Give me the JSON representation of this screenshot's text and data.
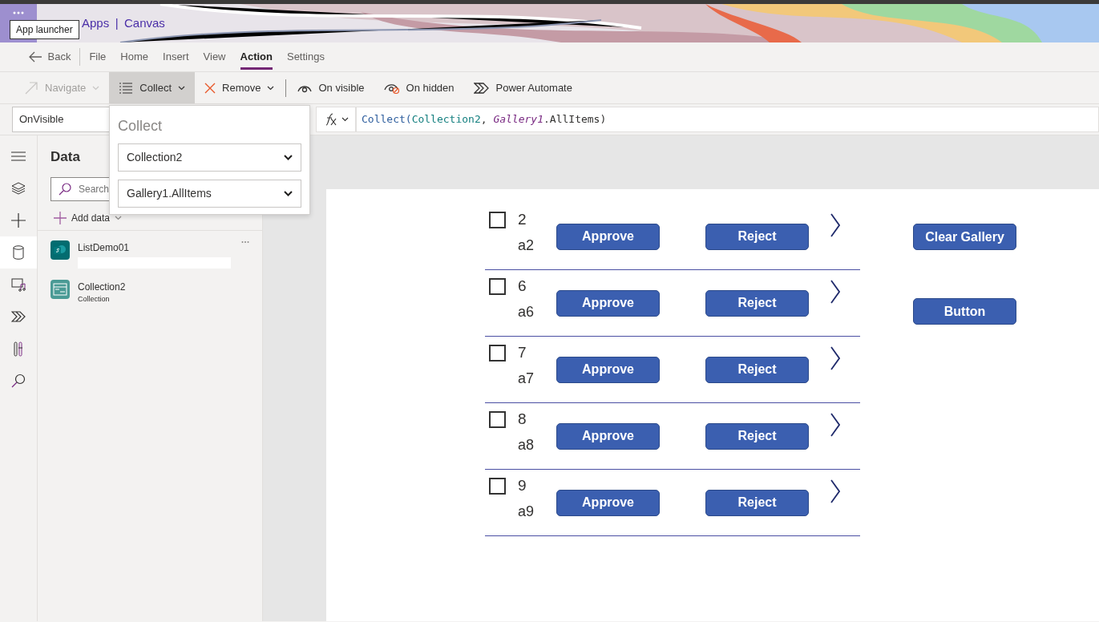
{
  "header": {
    "launcher_tooltip": "App launcher",
    "app_title": "Apps",
    "separator": "|",
    "section": "Canvas"
  },
  "menu": {
    "back": "Back",
    "tabs": [
      {
        "label": "File",
        "selected": false
      },
      {
        "label": "Home",
        "selected": false
      },
      {
        "label": "Insert",
        "selected": false
      },
      {
        "label": "View",
        "selected": false
      },
      {
        "label": "Action",
        "selected": true
      },
      {
        "label": "Settings",
        "selected": false
      }
    ]
  },
  "toolbar": [
    {
      "label": "Navigate",
      "disabled": true,
      "dropdown": true,
      "selected": false
    },
    {
      "label": "Collect",
      "disabled": false,
      "dropdown": true,
      "selected": true
    },
    {
      "label": "Remove",
      "disabled": false,
      "dropdown": true,
      "selected": false
    },
    {
      "label": "On visible",
      "disabled": false,
      "dropdown": false,
      "selected": false
    },
    {
      "label": "On hidden",
      "disabled": false,
      "dropdown": false,
      "selected": false
    },
    {
      "label": "Power Automate",
      "disabled": false,
      "dropdown": false,
      "selected": false
    }
  ],
  "property": "OnVisible",
  "formula": [
    {
      "kind": "function",
      "text": "Collect("
    },
    {
      "kind": "collection",
      "text": "Collection2"
    },
    {
      "kind": "plain",
      "text": ", "
    },
    {
      "kind": "control",
      "text": "Gallery1"
    },
    {
      "kind": "plain",
      "text": ".AllItems)"
    }
  ],
  "collect_popup": {
    "title": "Collect",
    "fields": [
      {
        "value": "Collection2"
      },
      {
        "value": "Gallery1.AllItems"
      }
    ]
  },
  "rail": [
    {
      "selected": false
    },
    {
      "selected": false
    },
    {
      "selected": false
    },
    {
      "selected": true
    },
    {
      "selected": false
    },
    {
      "selected": false
    },
    {
      "selected": false
    },
    {
      "selected": false
    }
  ],
  "data_panel": {
    "title": "Data",
    "search_placeholder": "Search",
    "add_data": "Add data",
    "sources": [
      {
        "kind": "sharepoint",
        "name": "ListDemo01"
      },
      {
        "kind": "collection",
        "name": "Collection2",
        "subtitle": "Collection"
      }
    ]
  },
  "gallery": [
    {
      "title": "2",
      "subtitle": "a2",
      "checked": false,
      "approve": "Approve",
      "reject": "Reject"
    },
    {
      "title": "6",
      "subtitle": "a6",
      "checked": false,
      "approve": "Approve",
      "reject": "Reject"
    },
    {
      "title": "7",
      "subtitle": "a7",
      "checked": false,
      "approve": "Approve",
      "reject": "Reject"
    },
    {
      "title": "8",
      "subtitle": "a8",
      "checked": false,
      "approve": "Approve",
      "reject": "Reject"
    },
    {
      "title": "9",
      "subtitle": "a9",
      "checked": false,
      "approve": "Approve",
      "reject": "Reject"
    }
  ],
  "canvas_buttons": [
    "Clear Gallery",
    "Button"
  ]
}
